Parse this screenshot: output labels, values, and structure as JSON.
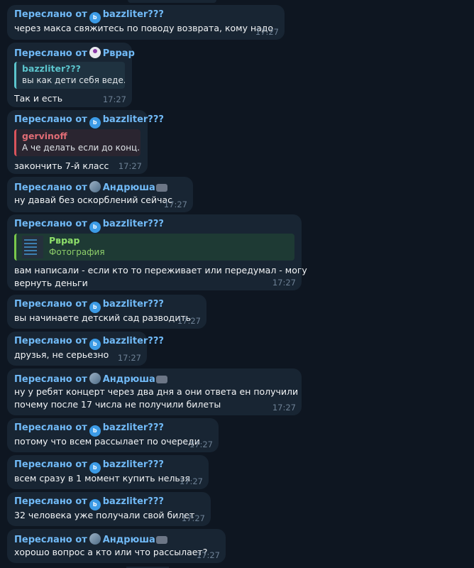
{
  "forward_prefix": "Переслано от",
  "messages": [
    {
      "from": "bazzliter???",
      "av": "b",
      "text": "через макса свяжитесь по поводу возврата, кому надо",
      "time": "17:27"
    },
    {
      "from": "Рврар",
      "av": "r",
      "quote": {
        "name": "bazzliter???",
        "text": "вы как дети себя веде...",
        "style": "cyan"
      },
      "text": "Так и есть",
      "time": "17:27"
    },
    {
      "from": "bazzliter???",
      "av": "b",
      "quote": {
        "name": "gervinoff",
        "text": "А че делать если до конц...",
        "style": "red"
      },
      "text": "закончить 7-й класс",
      "time": "17:27"
    },
    {
      "from": "Андрюша",
      "av": "a",
      "pad": true,
      "text": "ну давай без оскорблений сейчас",
      "time": "17:27"
    },
    {
      "from": "bazzliter???",
      "av": "b",
      "quote": {
        "name": "Рврар",
        "text": "Фотография",
        "style": "green"
      },
      "text": "вам написали - если кто то переживает или передумал - могу",
      "text2": "вернуть деньги",
      "time": "17:27"
    },
    {
      "from": "bazzliter???",
      "av": "b",
      "text": "вы начинаете детский сад разводить",
      "time": "17:27"
    },
    {
      "from": "bazzliter???",
      "av": "b",
      "text": "друзья, не серьезно",
      "time": "17:27"
    },
    {
      "from": "Андрюша",
      "av": "a",
      "pad": true,
      "text": "ну у ребят концерт через два дня а они ответа ен получили",
      "text2": "почему после 17 числа не получили билеты",
      "time": "17:27"
    },
    {
      "from": "bazzliter???",
      "av": "b",
      "text": "потому что всем рассылает по очереди",
      "time": "17:27"
    },
    {
      "from": "bazzliter???",
      "av": "b",
      "text": "всем сразу в 1 момент купить нельзя",
      "time": "17:27"
    },
    {
      "from": "bazzliter???",
      "av": "b",
      "text": "32 человека уже получали свой билет",
      "time": "17:27"
    },
    {
      "from": "Андрюша",
      "av": "a",
      "pad": true,
      "text": "хорошо вопрос а кто или что рассылает?",
      "time": "17:27"
    }
  ]
}
